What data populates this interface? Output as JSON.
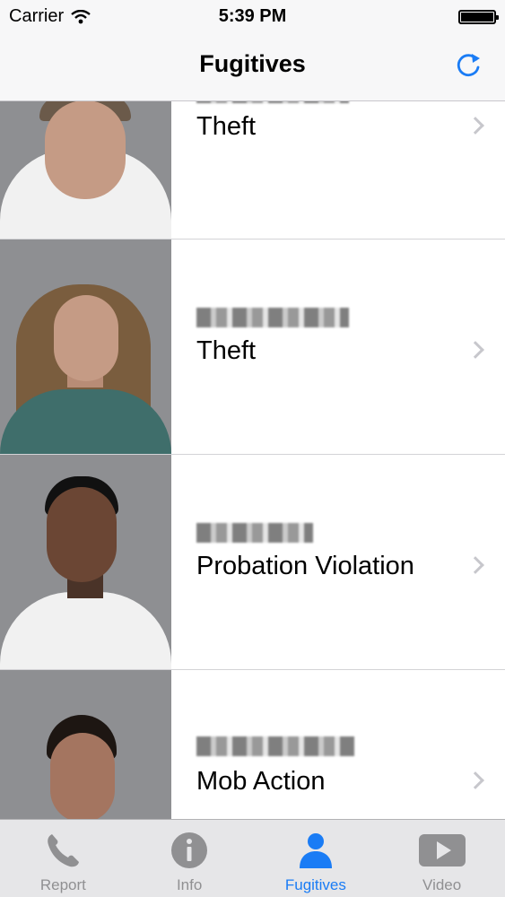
{
  "status_bar": {
    "carrier": "Carrier",
    "time": "5:39 PM"
  },
  "nav": {
    "title": "Fugitives",
    "refresh_icon": "refresh-icon"
  },
  "fugitives": [
    {
      "crime": "Theft"
    },
    {
      "crime": "Theft"
    },
    {
      "crime": "Probation Violation"
    },
    {
      "crime": "Mob Action"
    }
  ],
  "tabs": [
    {
      "label": "Report",
      "icon": "phone-icon",
      "active": false
    },
    {
      "label": "Info",
      "icon": "info-icon",
      "active": false
    },
    {
      "label": "Fugitives",
      "icon": "person-icon",
      "active": true
    },
    {
      "label": "Video",
      "icon": "play-icon",
      "active": false
    }
  ],
  "colors": {
    "accent": "#1a7cf5",
    "tab_inactive": "#909092",
    "nav_bg": "#f7f7f8"
  }
}
